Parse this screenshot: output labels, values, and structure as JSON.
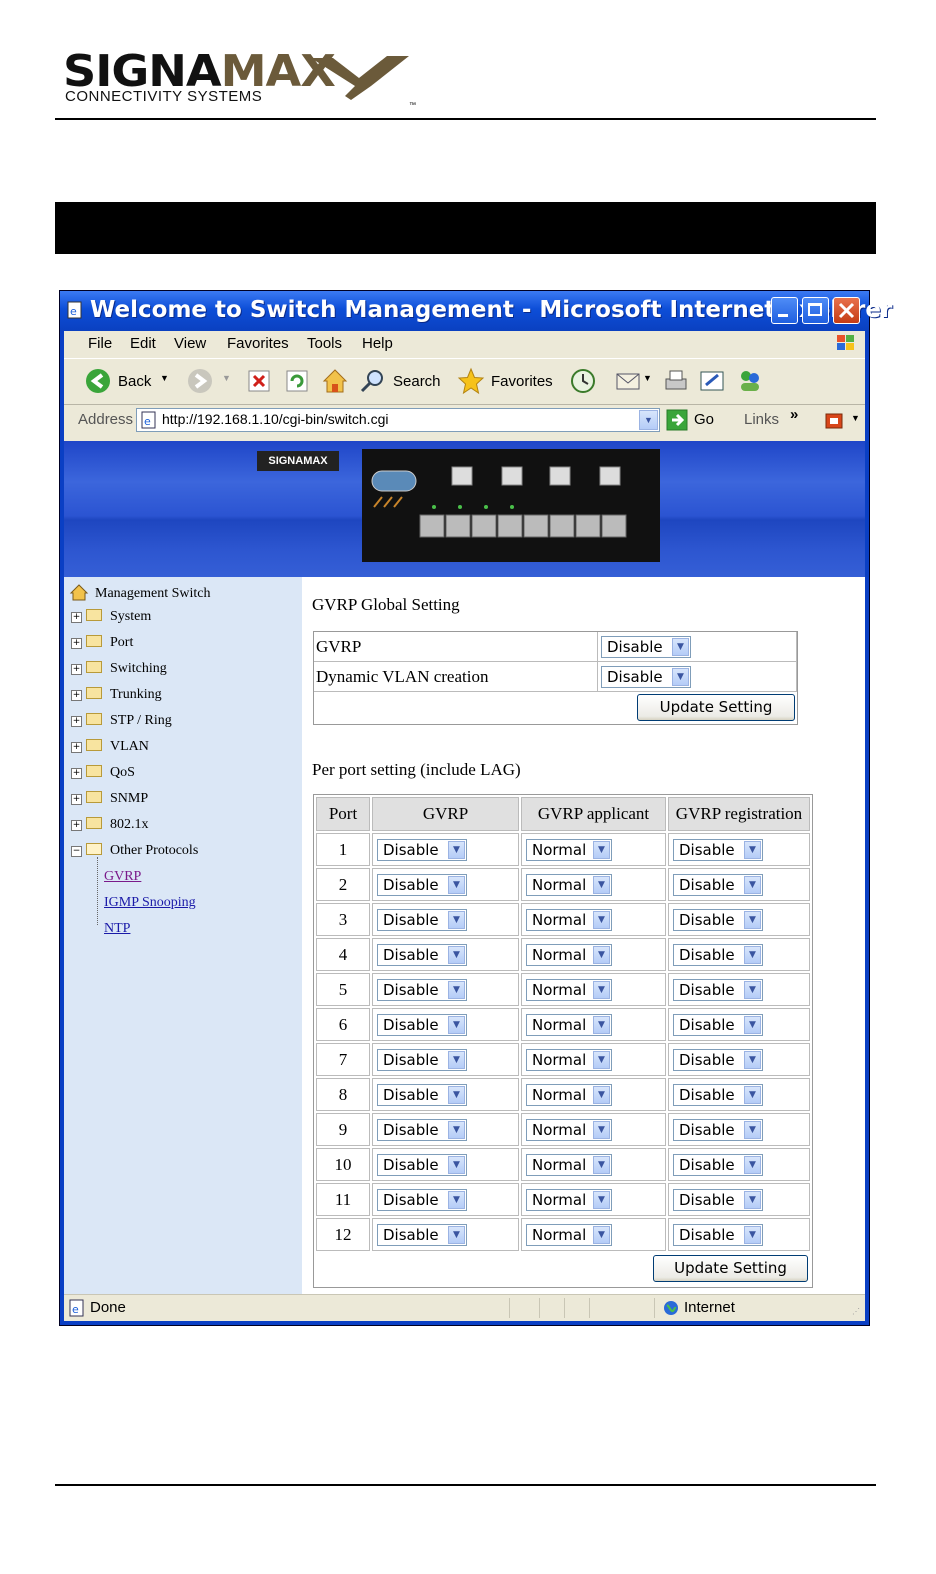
{
  "doc": {
    "logo_brand_a": "SIGNA",
    "logo_brand_b": "MAX",
    "logo_tagline": "CONNECTIVITY SYSTEMS",
    "logo_tm": "™"
  },
  "window": {
    "title": "Welcome to Switch Management - Microsoft Internet Explorer",
    "menu": [
      "File",
      "Edit",
      "View",
      "Favorites",
      "Tools",
      "Help"
    ],
    "toolbar": {
      "back": "Back",
      "search": "Search",
      "favorites": "Favorites"
    },
    "address_label": "Address",
    "url": "http://192.168.1.10/cgi-bin/switch.cgi",
    "go": "Go",
    "links": "Links",
    "links_chevron": "»",
    "status": "Done",
    "zone": "Internet"
  },
  "banner": {
    "mini_logo": "SIGNAMAX"
  },
  "nav": {
    "root": "Management Switch",
    "folders": [
      "System",
      "Port",
      "Switching",
      "Trunking",
      "STP / Ring",
      "VLAN",
      "QoS",
      "SNMP",
      "802.1x"
    ],
    "open_folder": "Other Protocols",
    "links": [
      "GVRP",
      "IGMP Snooping",
      "NTP"
    ]
  },
  "global": {
    "heading": "GVRP Global Setting",
    "rows": [
      {
        "label": "GVRP",
        "value": "Disable"
      },
      {
        "label": "Dynamic VLAN creation",
        "value": "Disable"
      }
    ],
    "update": "Update Setting"
  },
  "perport": {
    "heading": "Per port setting (include LAG)",
    "headers": [
      "Port",
      "GVRP",
      "GVRP applicant",
      "GVRP registration"
    ],
    "rows": [
      {
        "port": "1",
        "gvrp": "Disable",
        "applicant": "Normal",
        "registration": "Disable"
      },
      {
        "port": "2",
        "gvrp": "Disable",
        "applicant": "Normal",
        "registration": "Disable"
      },
      {
        "port": "3",
        "gvrp": "Disable",
        "applicant": "Normal",
        "registration": "Disable"
      },
      {
        "port": "4",
        "gvrp": "Disable",
        "applicant": "Normal",
        "registration": "Disable"
      },
      {
        "port": "5",
        "gvrp": "Disable",
        "applicant": "Normal",
        "registration": "Disable"
      },
      {
        "port": "6",
        "gvrp": "Disable",
        "applicant": "Normal",
        "registration": "Disable"
      },
      {
        "port": "7",
        "gvrp": "Disable",
        "applicant": "Normal",
        "registration": "Disable"
      },
      {
        "port": "8",
        "gvrp": "Disable",
        "applicant": "Normal",
        "registration": "Disable"
      },
      {
        "port": "9",
        "gvrp": "Disable",
        "applicant": "Normal",
        "registration": "Disable"
      },
      {
        "port": "10",
        "gvrp": "Disable",
        "applicant": "Normal",
        "registration": "Disable"
      },
      {
        "port": "11",
        "gvrp": "Disable",
        "applicant": "Normal",
        "registration": "Disable"
      },
      {
        "port": "12",
        "gvrp": "Disable",
        "applicant": "Normal",
        "registration": "Disable"
      }
    ],
    "update": "Update Setting"
  }
}
